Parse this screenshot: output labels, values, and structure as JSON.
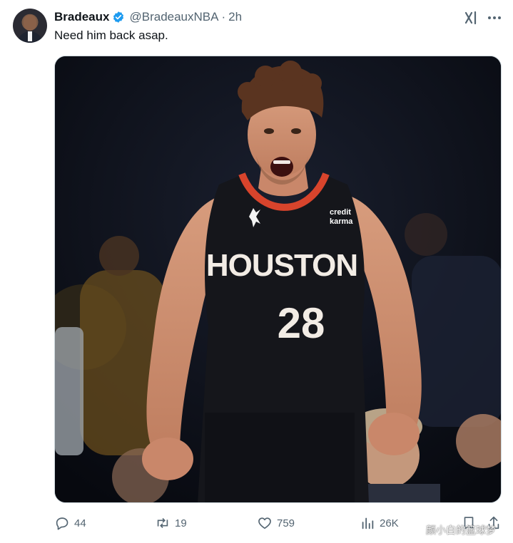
{
  "tweet": {
    "author_name": "Bradeaux",
    "handle": "@BradeauxNBA",
    "separator": "·",
    "time": "2h",
    "text": "Need him back asap."
  },
  "media": {
    "jersey_sponsor_line1": "credit",
    "jersey_sponsor_line2": "karma",
    "jersey_team": "HOUSTON",
    "jersey_number": "28"
  },
  "actions": {
    "replies": "44",
    "reposts": "19",
    "likes": "759",
    "views": "26K"
  },
  "watermark": "颜小白的篮球梦",
  "colors": {
    "verified_blue": "#1d9bf0",
    "text_primary": "#0f1419",
    "text_secondary": "#536471",
    "jersey_black": "#15161b",
    "jersey_red": "#d8442c"
  },
  "icons": {
    "verified": "verified-badge-icon",
    "grok": "grok-icon",
    "more": "more-icon",
    "reply": "reply-icon",
    "retweet": "retweet-icon",
    "like": "heart-icon",
    "views": "views-chart-icon",
    "bookmark": "bookmark-icon",
    "share": "share-icon"
  }
}
